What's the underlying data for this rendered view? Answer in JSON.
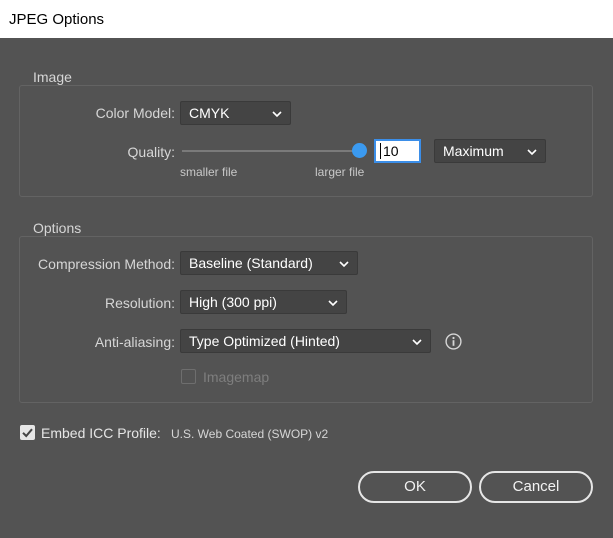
{
  "window": {
    "title": "JPEG Options"
  },
  "image_group": {
    "legend": "Image",
    "color_model": {
      "label": "Color Model:",
      "value": "CMYK"
    },
    "quality": {
      "label": "Quality:",
      "value": "10",
      "slider_fraction": 1.0,
      "min_label": "smaller file",
      "max_label": "larger file",
      "preset": "Maximum"
    }
  },
  "options_group": {
    "legend": "Options",
    "compression": {
      "label": "Compression Method:",
      "value": "Baseline (Standard)"
    },
    "resolution": {
      "label": "Resolution:",
      "value": "High (300 ppi)"
    },
    "antialiasing": {
      "label": "Anti-aliasing:",
      "value": "Type Optimized (Hinted)"
    },
    "imagemap": {
      "label": "Imagemap",
      "checked": false,
      "enabled": false
    }
  },
  "embed_icc": {
    "label": "Embed ICC Profile:",
    "profile": "U.S. Web Coated (SWOP) v2",
    "checked": true
  },
  "buttons": {
    "ok": "OK",
    "cancel": "Cancel"
  },
  "colors": {
    "background": "#535353",
    "accent": "#3b9af0",
    "panel_border": "#636363"
  },
  "icons": [
    "chevron-down-icon",
    "info-icon",
    "checkmark-icon"
  ]
}
